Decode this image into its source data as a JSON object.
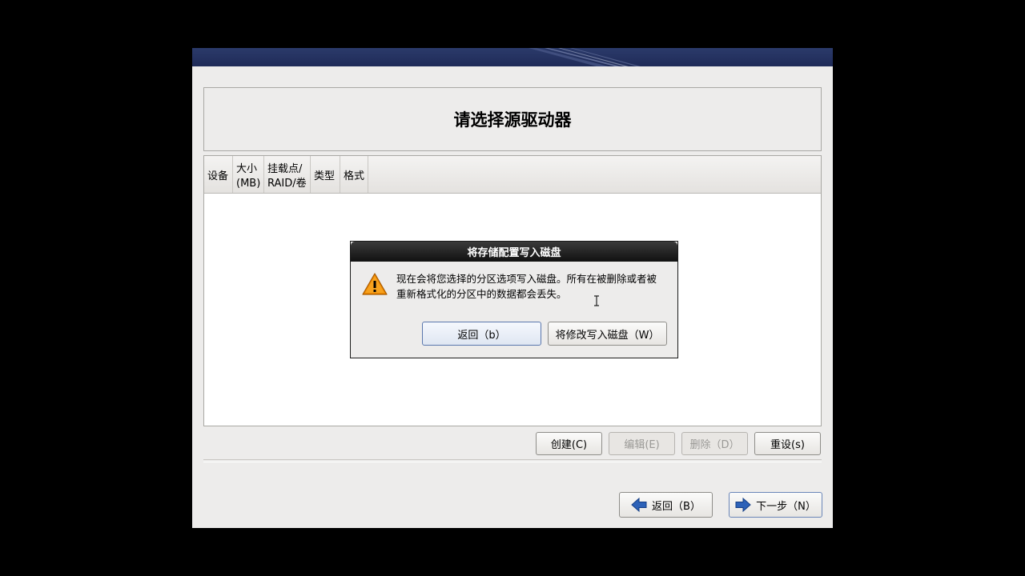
{
  "page": {
    "title": "请选择源驱动器"
  },
  "table": {
    "columns": [
      {
        "line1": "设备",
        "line2": ""
      },
      {
        "line1": "大小",
        "line2": "(MB)"
      },
      {
        "line1": "挂载点/",
        "line2": "RAID/卷"
      },
      {
        "line1": "类型",
        "line2": ""
      },
      {
        "line1": "格式",
        "line2": ""
      }
    ]
  },
  "actions": {
    "create": "创建(C)",
    "edit": "编辑(E)",
    "delete": "删除（D）",
    "reset": "重设(s)"
  },
  "nav": {
    "back": "返回（B）",
    "next": "下一步（N）"
  },
  "dialog": {
    "title": "将存储配置写入磁盘",
    "message_line1": "现在会将您选择的分区选项写入磁盘。所有在被删除或者被",
    "message_line2": "重新格式化的分区中的数据都会丢失。",
    "back_button": "返回（b）",
    "write_button": "将修改写入磁盘（W）"
  },
  "colors": {
    "banner": "#1f2b58",
    "warning": "#f08a00",
    "nav_arrow": "#2d62b8"
  },
  "icons": {
    "warning": "warning-icon",
    "back_arrow": "arrow-left-icon",
    "next_arrow": "arrow-right-icon",
    "cursor": "text-cursor-icon"
  }
}
